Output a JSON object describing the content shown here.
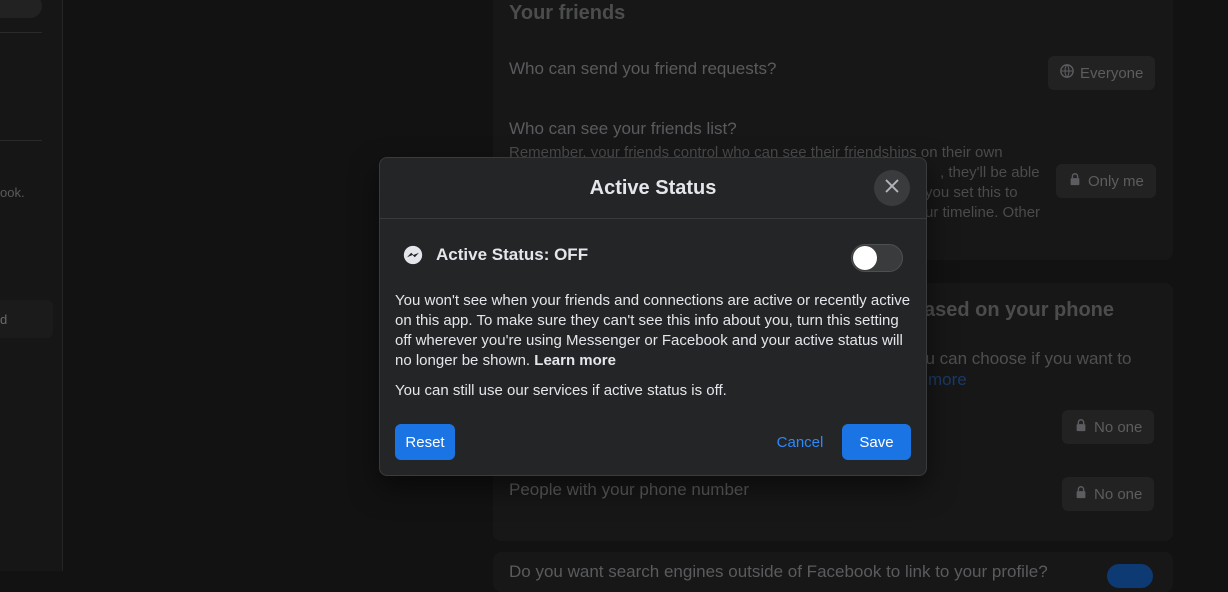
{
  "background": {
    "sidebar_fragments": [
      "ook.",
      "d"
    ],
    "your_friends": {
      "title": "Your friends",
      "q1": "Who can send you friend requests?",
      "q1_value": "Everyone",
      "q2": "Who can see your friends list?",
      "q2_desc": "Remember, your friends control who can see their friendships on their own",
      "q2_desc_frag1": ", they'll be able",
      "q2_desc_frag2": "you set this to",
      "q2_desc_frag3": "ur timeline. Other",
      "q2_value": "Only me"
    },
    "phone_section": {
      "title_frag": "ased on your phone",
      "desc_frag": "ou can choose if you want to",
      "link_frag": "more",
      "value1": "No one",
      "q2": "People with your phone number",
      "value2": "No one"
    },
    "search_engines": {
      "q": "Do you want search engines outside of Facebook to link to your profile?"
    }
  },
  "modal": {
    "title": "Active Status",
    "status_label": "Active Status: OFF",
    "toggle_on": false,
    "body": "You won't see when your friends and connections are active or recently active on this app. To make sure they can't see this info about you, turn this setting off wherever you're using Messenger or Facebook and your active status will no longer be shown.",
    "learn_more": "Learn more",
    "body2": "You can still use our services if active status is off.",
    "reset_label": "Reset",
    "cancel_label": "Cancel",
    "save_label": "Save"
  },
  "colors": {
    "primary": "#1b74e4",
    "link": "#2d88ff",
    "modal_bg": "#242526"
  }
}
